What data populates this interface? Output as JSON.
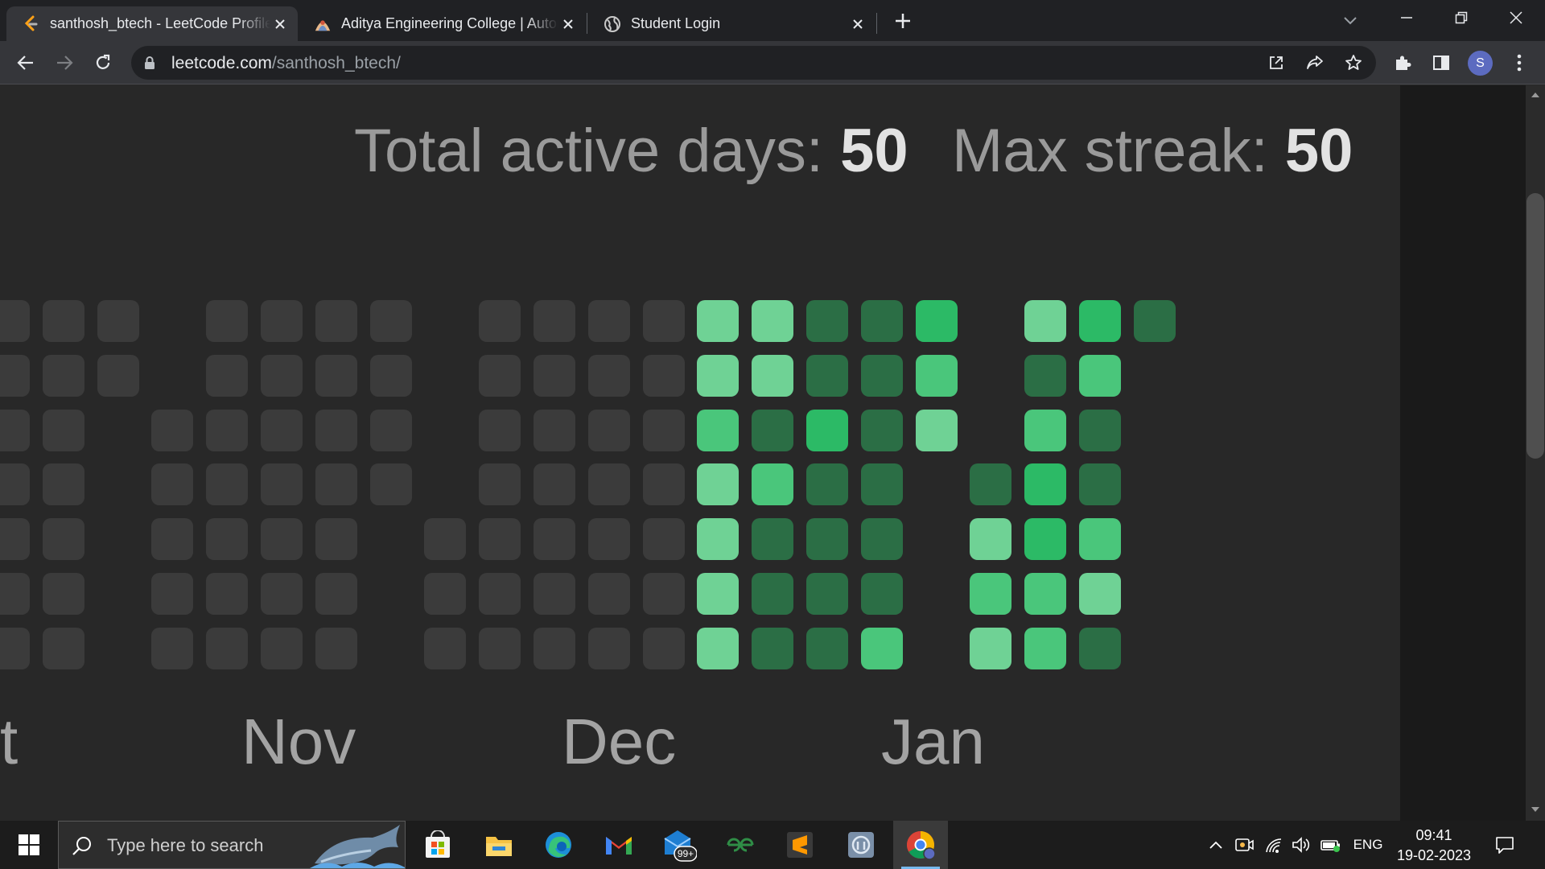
{
  "browser": {
    "tabs": [
      {
        "title": "santhosh_btech - LeetCode Profile",
        "active": true,
        "icon": "leetcode-icon"
      },
      {
        "title": "Aditya Engineering College | Autonomous",
        "active": false,
        "icon": "college-logo-icon"
      },
      {
        "title": "Student Login",
        "active": false,
        "icon": "globe-icon"
      }
    ],
    "url_host": "leetcode.com",
    "url_path": "/santhosh_btech/",
    "profile_initial": "S"
  },
  "stats": {
    "active_days_label": "Total active days:",
    "active_days_value": "50",
    "max_streak_label": "Max streak:",
    "max_streak_value": "50"
  },
  "calendar": {
    "months": [
      "t",
      "Nov",
      "Dec",
      "Jan"
    ],
    "colors": {
      "empty": "#3b3b3b",
      "level1": "#6fd295",
      "level2": "#4ac67b",
      "level3": "#2cba66",
      "level4": "#2b6e45"
    }
  },
  "taskbar": {
    "search_placeholder": "Type here to search",
    "mail_badge": "99+",
    "language": "ENG",
    "time": "09:41",
    "date": "19-02-2023"
  }
}
